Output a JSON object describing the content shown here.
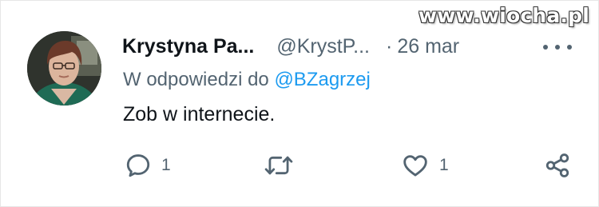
{
  "watermark": "www.wiocha.pl",
  "tweet": {
    "author_name": "Krystyna Pa...",
    "handle": "@KrystP...",
    "separator": "·",
    "date": "26 mar",
    "reply_prefix": "W odpowiedzi do",
    "reply_to": "@BZagrzej",
    "text": "Zob w internecie."
  },
  "actions": {
    "reply_count": "1",
    "like_count": "1"
  },
  "icons": [
    "more-icon",
    "reply-icon",
    "retweet-icon",
    "like-icon",
    "share-icon"
  ],
  "colors": {
    "text": "#0f1419",
    "secondary": "#536471",
    "link": "#1d9bf0"
  }
}
